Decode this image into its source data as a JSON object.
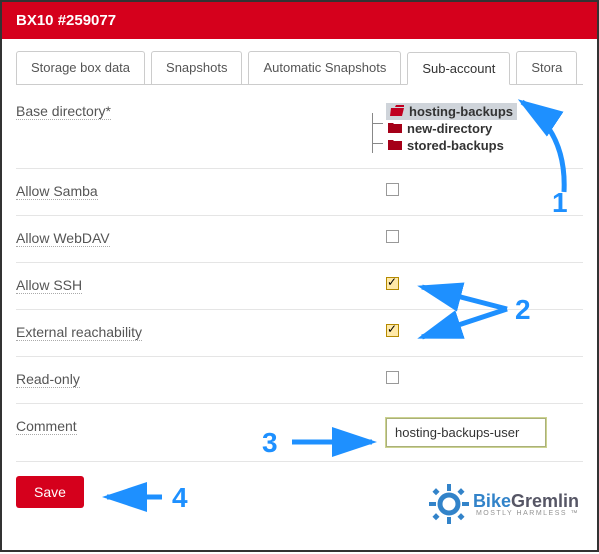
{
  "header": {
    "title": "BX10 #259077"
  },
  "tabs": [
    {
      "label": "Storage box data",
      "active": false
    },
    {
      "label": "Snapshots",
      "active": false
    },
    {
      "label": "Automatic Snapshots",
      "active": false
    },
    {
      "label": "Sub-account",
      "active": true
    },
    {
      "label": "Stora",
      "active": false
    }
  ],
  "form": {
    "base_dir_label": "Base directory*",
    "tree": [
      {
        "name": "hosting-backups",
        "selected": true,
        "open": true
      },
      {
        "name": "new-directory",
        "selected": false,
        "open": false
      },
      {
        "name": "stored-backups",
        "selected": false,
        "open": false
      }
    ],
    "allow_samba": {
      "label": "Allow Samba",
      "checked": false
    },
    "allow_webdav": {
      "label": "Allow WebDAV",
      "checked": false
    },
    "allow_ssh": {
      "label": "Allow SSH",
      "checked": true
    },
    "ext_reach": {
      "label": "External reachability",
      "checked": true
    },
    "read_only": {
      "label": "Read-only",
      "checked": false
    },
    "comment": {
      "label": "Comment",
      "value": "hosting-backups-user"
    },
    "save_label": "Save"
  },
  "annotations": {
    "n1": "1",
    "n2": "2",
    "n3": "3",
    "n4": "4"
  },
  "watermark": {
    "brand_a": "Bike",
    "brand_b": "Gremlin",
    "tag": "MOSTLY HARMLESS ™"
  },
  "colors": {
    "brand_red": "#d5001c",
    "anno_blue": "#1e90ff"
  }
}
